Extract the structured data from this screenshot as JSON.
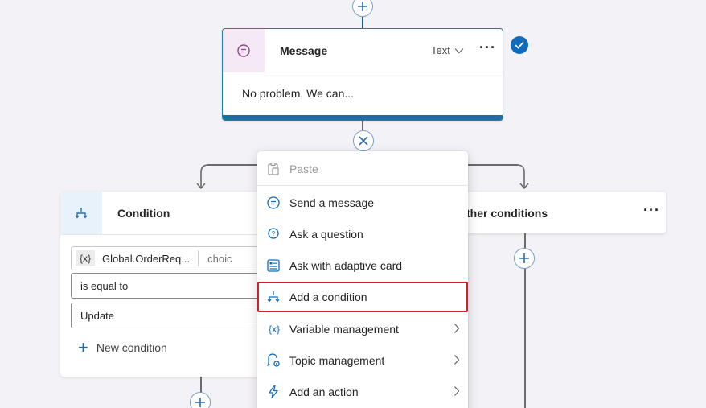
{
  "message_card": {
    "title": "Message",
    "type_label": "Text",
    "more": "···",
    "body": "No problem. We can..."
  },
  "condition_card": {
    "title": "Condition",
    "variable_chip": "{x}",
    "variable_name": "Global.OrderReq...",
    "variable_type": "choic",
    "operator": "is equal to",
    "value": "Update",
    "new_condition_label": "New condition"
  },
  "other_card": {
    "title": "ther conditions",
    "more": "···"
  },
  "context_menu": {
    "items": [
      {
        "label": "Paste",
        "icon": "paste-icon",
        "disabled": true,
        "submenu": false
      },
      {
        "label": "Send a message",
        "icon": "message-icon",
        "disabled": false,
        "submenu": false
      },
      {
        "label": "Ask a question",
        "icon": "question-icon",
        "disabled": false,
        "submenu": false
      },
      {
        "label": "Ask with adaptive card",
        "icon": "adaptive-card-icon",
        "disabled": false,
        "submenu": false
      },
      {
        "label": "Add a condition",
        "icon": "branch-icon",
        "disabled": false,
        "submenu": false,
        "highlighted": true
      },
      {
        "label": "Variable management",
        "icon": "variable-icon",
        "disabled": false,
        "submenu": true
      },
      {
        "label": "Topic management",
        "icon": "topic-icon",
        "disabled": false,
        "submenu": true
      },
      {
        "label": "Add an action",
        "icon": "lightning-icon",
        "disabled": false,
        "submenu": true
      }
    ]
  },
  "colors": {
    "accent": "#0f6cbd",
    "card_border": "#1e7fae",
    "highlight_outline": "#d21f2b",
    "background": "#f3f2f6"
  }
}
